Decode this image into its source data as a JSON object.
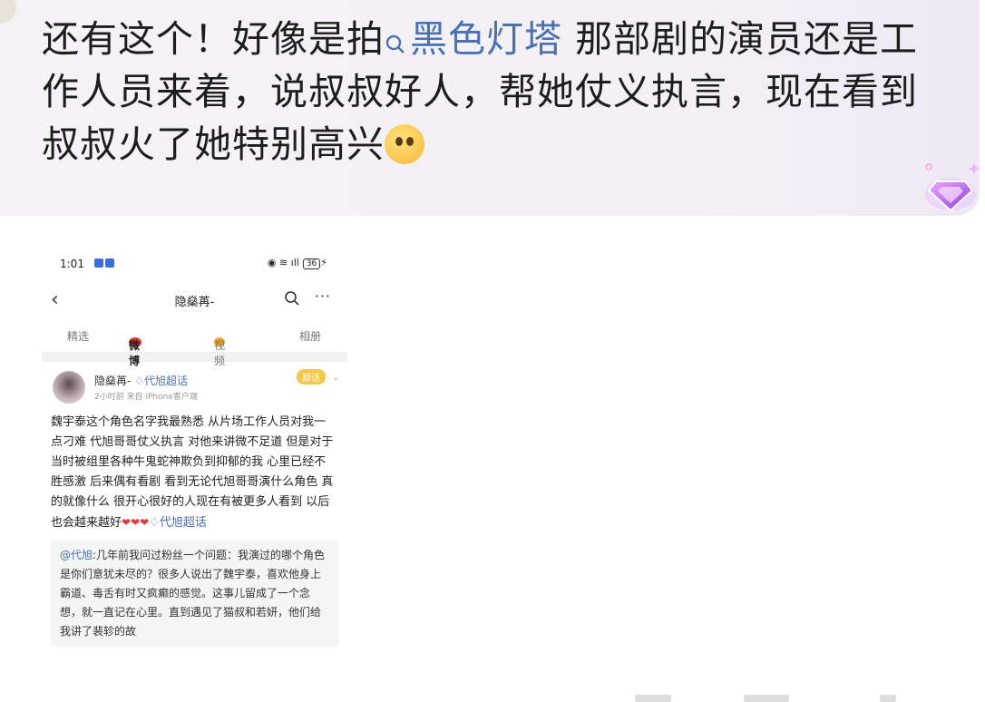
{
  "comment": {
    "text_before": "还有这个！好像是拍",
    "topic_label": "黑色灯塔",
    "text_after": " 那部剧的演员还是工作人员来着，说叔叔好人，帮她仗义执言，现在看到叔叔火了她特别高兴"
  },
  "screenshot": {
    "status_time": "1:01",
    "battery": "36",
    "profile_name": "隐燊苒-",
    "tabs": [
      "精选",
      "微博",
      "视频",
      "相册"
    ],
    "post": {
      "author": "隐燊苒-",
      "author_topic": "代旭超话",
      "meta": "2小时前  来自 iPhone客户端",
      "badge": "超话",
      "body": "魏宇泰这个角色名字我最熟悉 从片场工作人员对我一点刁难 代旭哥哥仗义执言 对他来讲微不足道 但是对于当时被组里各种牛鬼蛇神欺负到抑郁的我 心里已经不胜感激 后来偶有看剧 看到无论代旭哥哥演什么角色 真的就像什么 很开心很好的人现在有被更多人看到 以后也会越来越好",
      "hearts": "❤❤❤",
      "body_topic": "代旭超话"
    },
    "repost": {
      "mention": "@代旭",
      "text": ":几年前我问过粉丝一个问题：我演过的哪个角色是你们意犹未尽的？很多人说出了魏宇泰，喜欢他身上霸道、毒舌有时又疯癫的感觉。这事儿留成了一个念想，就一直记在心里。直到遇见了猫叔和若妍，他们给我讲了裴轸的故"
    }
  }
}
